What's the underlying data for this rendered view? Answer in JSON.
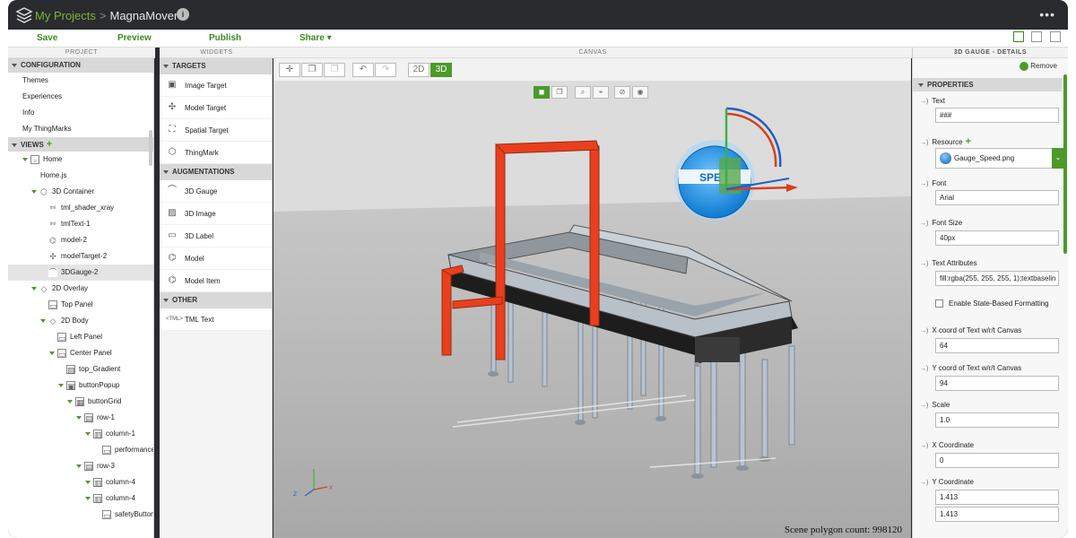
{
  "titlebar": {
    "breadcrumb_root": "My Projects",
    "separator": ">",
    "project_name": "MagnaMover",
    "info_glyph": "i",
    "more_glyph": "•••"
  },
  "toolbar": {
    "save": "Save",
    "preview": "Preview",
    "publish": "Publish",
    "share": "Share ▾"
  },
  "panels": {
    "project": "PROJECT",
    "widgets": "WIDGETS",
    "canvas": "CANVAS",
    "details": "3D GAUGE - DETAILS"
  },
  "project": {
    "configuration": "CONFIGURATION",
    "config_items": [
      "Themes",
      "Experiences",
      "Info",
      "My ThingMarks"
    ],
    "views": "VIEWS",
    "tree": [
      {
        "label": "Home",
        "level": 0,
        "arrow": true,
        "icon": "view"
      },
      {
        "label": "Home.js",
        "level": 1,
        "arrow": false,
        "icon": "none"
      },
      {
        "label": "3D Container",
        "level": 1,
        "arrow": true,
        "icon": "cube"
      },
      {
        "label": "tml_shader_xray",
        "level": 2,
        "arrow": false,
        "icon": "tml"
      },
      {
        "label": "tmlText-1",
        "level": 2,
        "arrow": false,
        "icon": "tml"
      },
      {
        "label": "model-2",
        "level": 2,
        "arrow": false,
        "icon": "model"
      },
      {
        "label": "modelTarget-2",
        "level": 2,
        "arrow": false,
        "icon": "target"
      },
      {
        "label": "3DGauge-2",
        "level": 2,
        "arrow": false,
        "icon": "gauge",
        "selected": true
      },
      {
        "label": "2D Overlay",
        "level": 1,
        "arrow": true,
        "icon": "overlay"
      },
      {
        "label": "Top Panel",
        "level": 2,
        "arrow": false,
        "icon": "panel"
      },
      {
        "label": "2D Body",
        "level": 2,
        "arrow": true,
        "icon": "overlay"
      },
      {
        "label": "Left Panel",
        "level": 3,
        "arrow": false,
        "icon": "panel"
      },
      {
        "label": "Center Panel",
        "level": 3,
        "arrow": true,
        "icon": "panel"
      },
      {
        "label": "top_Gradient",
        "level": 4,
        "arrow": false,
        "icon": "image"
      },
      {
        "label": "buttonPopup",
        "level": 4,
        "arrow": true,
        "icon": "popup"
      },
      {
        "label": "buttonGrid",
        "level": 5,
        "arrow": true,
        "icon": "grid"
      },
      {
        "label": "row-1",
        "level": 6,
        "arrow": true,
        "icon": "row"
      },
      {
        "label": "column-1",
        "level": 7,
        "arrow": true,
        "icon": "col"
      },
      {
        "label": "performanceB",
        "level": 8,
        "arrow": false,
        "icon": "button"
      },
      {
        "label": "row-3",
        "level": 6,
        "arrow": true,
        "icon": "row"
      },
      {
        "label": "column-4",
        "level": 7,
        "arrow": true,
        "icon": "col"
      },
      {
        "label": "column-4",
        "level": 7,
        "arrow": true,
        "icon": "col"
      },
      {
        "label": "safetyButton",
        "level": 8,
        "arrow": false,
        "icon": "button"
      }
    ]
  },
  "widgets": {
    "targets": "TARGETS",
    "target_items": [
      "Image Target",
      "Model Target",
      "Spatial Target",
      "ThingMark"
    ],
    "augmentations": "AUGMENTATIONS",
    "augmentation_items": [
      "3D Gauge",
      "3D Image",
      "3D Label",
      "Model",
      "Model Item"
    ],
    "other": "OTHER",
    "other_items": [
      "TML Text"
    ]
  },
  "canvas": {
    "mode_2d": "2D",
    "mode_3d": "3D",
    "mode_selected": "3D",
    "gauge_text": "SPE",
    "polygon_count": "Scene polygon count: 998120"
  },
  "details": {
    "remove": "Remove",
    "properties": "PROPERTIES",
    "text_label": "Text",
    "text_value": "###",
    "resource_label": "Resource",
    "resource_value": "Gauge_Speed.png",
    "font_label": "Font",
    "font_value": "Arial",
    "fontsize_label": "Font Size",
    "fontsize_value": "40px",
    "textattr_label": "Text Attributes",
    "textattr_value": "fill:rgba(255, 255, 255, 1);textbaselin",
    "state_label": "Enable State-Based Formatting",
    "xcanvas_label": "X coord of Text w/r/t Canvas",
    "xcanvas_value": "64",
    "ycanvas_label": "Y coord of Text w/r/t Canvas",
    "ycanvas_value": "94",
    "scale_label": "Scale",
    "scale_value": "1.0",
    "xcoord_label": "X Coordinate",
    "xcoord_value": "0",
    "ycoord_label": "Y Coordinate",
    "ycoord_value_1": "1.413",
    "ycoord_value_2": "1.413"
  },
  "colors": {
    "accent": "#4c9a2a",
    "frame": "#2a2b2e",
    "conveyor_frame": "#e8401e"
  }
}
